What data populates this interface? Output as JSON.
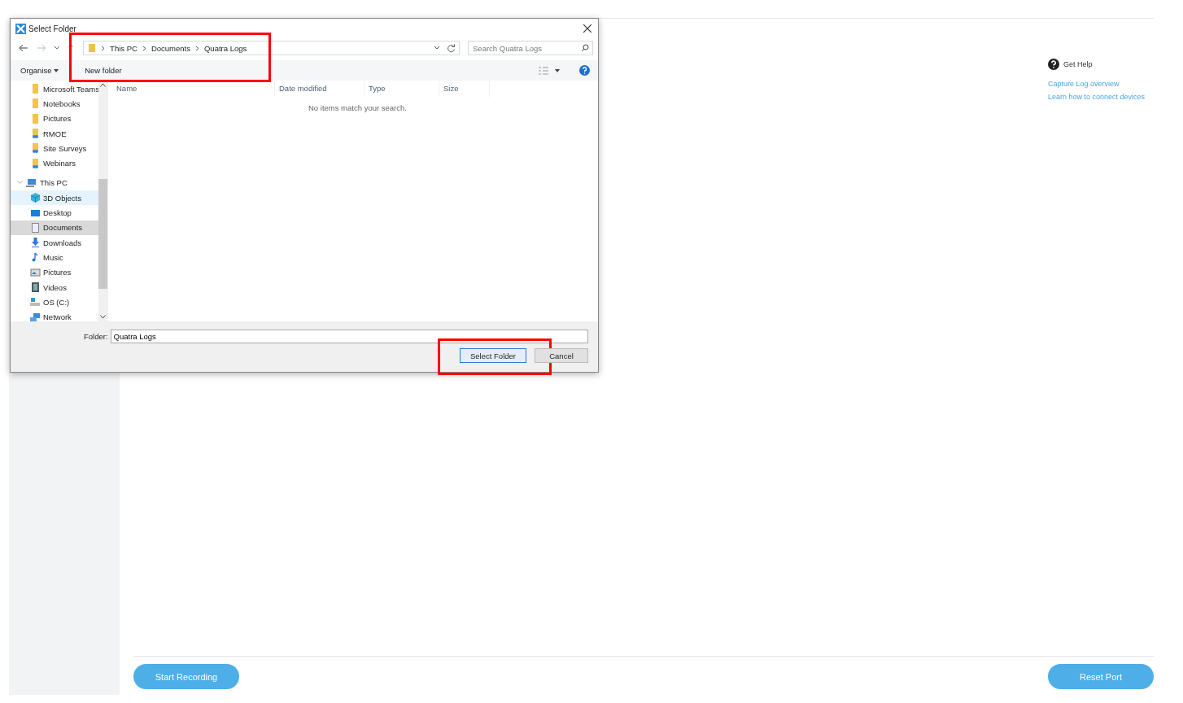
{
  "app": {
    "help": {
      "title": "Get Help",
      "links": [
        "Capture Log overview",
        "Learn how to connect devices"
      ]
    },
    "buttons": [
      {
        "label": "Start Recording"
      },
      {
        "label": "Reset Port"
      }
    ]
  },
  "dialog": {
    "title": "Select Folder",
    "breadcrumbs": {
      "highlighted": true,
      "items": [
        "This PC",
        "Documents",
        "Quatra Logs"
      ]
    },
    "search": {
      "placeholder": "Search Quatra Logs"
    },
    "toolbar": {
      "organise": "Organise",
      "new_folder": "New folder"
    },
    "nav_tree": [
      {
        "label": "Microsoft Teams",
        "kind": "folder",
        "selected": false,
        "hovered": false
      },
      {
        "label": "Notebooks",
        "kind": "folder",
        "selected": false,
        "hovered": false
      },
      {
        "label": "Pictures",
        "kind": "folder",
        "selected": false,
        "hovered": false
      },
      {
        "label": "RMOE",
        "kind": "shared",
        "selected": false,
        "hovered": false
      },
      {
        "label": "Site Surveys",
        "kind": "shared",
        "selected": false,
        "hovered": false
      },
      {
        "label": "Webinars",
        "kind": "shared",
        "selected": false,
        "hovered": false
      },
      {
        "label": "This PC",
        "kind": "pc",
        "selected": false,
        "hovered": false,
        "expanded": true,
        "children": [
          {
            "label": "3D Objects",
            "kind": "cube",
            "selected": false,
            "hovered": true
          },
          {
            "label": "Desktop",
            "kind": "desktop",
            "selected": false,
            "hovered": false
          },
          {
            "label": "Documents",
            "kind": "document",
            "selected": true,
            "hovered": false
          },
          {
            "label": "Downloads",
            "kind": "download",
            "selected": false,
            "hovered": false
          },
          {
            "label": "Music",
            "kind": "music",
            "selected": false,
            "hovered": false
          },
          {
            "label": "Pictures",
            "kind": "pictures",
            "selected": false,
            "hovered": false
          },
          {
            "label": "Videos",
            "kind": "videos",
            "selected": false,
            "hovered": false
          },
          {
            "label": "OS (C:)",
            "kind": "drive",
            "selected": false,
            "hovered": false
          }
        ]
      },
      {
        "label": "Network",
        "kind": "network",
        "selected": false,
        "hovered": false
      }
    ],
    "columns": [
      "Name",
      "Date modified",
      "Type",
      "Size"
    ],
    "empty_message": "No items match your search.",
    "folder_label": "Folder:",
    "folder_value": "Quatra Logs",
    "buttons": [
      {
        "label": "Select Folder",
        "kind": "primary",
        "highlighted": true
      },
      {
        "label": "Cancel",
        "kind": "secondary",
        "highlighted": false
      }
    ]
  }
}
